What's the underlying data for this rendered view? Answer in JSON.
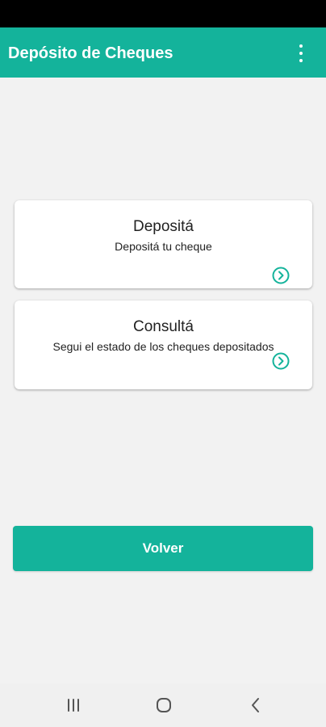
{
  "app_bar": {
    "title": "Depósito de Cheques",
    "menu_icon": "more-vert-icon",
    "color": "#14b39b"
  },
  "cards": [
    {
      "title": "Depositá",
      "subtitle": "Depositá tu cheque",
      "icon": "chevron-right-circle-icon"
    },
    {
      "title": "Consultá",
      "subtitle": "Segui el estado de los cheques depositados",
      "icon": "chevron-right-circle-icon"
    }
  ],
  "actions": {
    "back_label": "Volver"
  },
  "navigation_bar": {
    "icons": [
      "recents-icon",
      "home-icon",
      "back-icon"
    ]
  },
  "colors": {
    "accent": "#14b39b",
    "background": "#f2f2f2",
    "status_bar": "#000000"
  }
}
